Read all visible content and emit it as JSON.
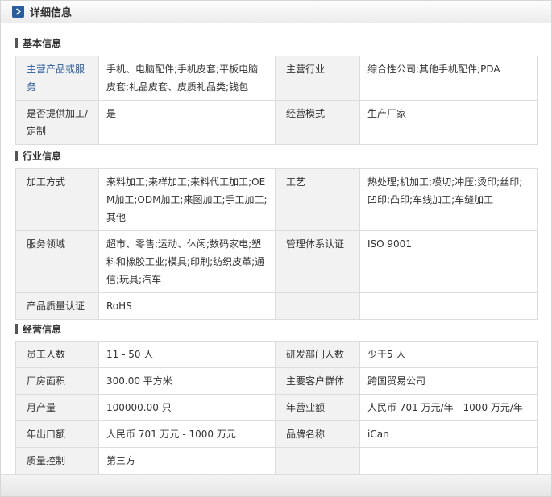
{
  "header": {
    "title": "详细信息"
  },
  "sections": [
    {
      "title": "基本信息",
      "rows": [
        [
          "主营产品或服务",
          "手机、电脑配件;手机皮套;平板电脑皮套;礼品皮套、皮质礼品类;钱包",
          "主营行业",
          "综合性公司;其他手机配件;PDA"
        ],
        [
          "是否提供加工/定制",
          "是",
          "经营模式",
          "生产厂家"
        ]
      ]
    },
    {
      "title": "行业信息",
      "rows": [
        [
          "加工方式",
          "来料加工;来样加工;来料代工加工;OEM加工;ODM加工;来图加工;手工加工;其他",
          "工艺",
          "热处理;机加工;模切;冲压;烫印;丝印;凹印;凸印;车线加工;车缝加工"
        ],
        [
          "服务领域",
          "超市、零售;运动、休闲;数码家电;塑料和橡胶工业;模具;印刷;纺织皮革;通信;玩具;汽车",
          "管理体系认证",
          "ISO 9001"
        ],
        [
          "产品质量认证",
          "RoHS",
          "",
          ""
        ]
      ]
    },
    {
      "title": "经营信息",
      "rows": [
        [
          "员工人数",
          "11 - 50 人",
          "研发部门人数",
          "少于5 人"
        ],
        [
          "厂房面积",
          "300.00 平方米",
          "主要客户群体",
          "跨国贸易公司"
        ],
        [
          "月产量",
          "100000.00 只",
          "年营业额",
          "人民币 701 万元/年 - 1000 万元/年"
        ],
        [
          "年出口额",
          "人民币 701 万元 - 1000 万元",
          "品牌名称",
          "iCan"
        ],
        [
          "质量控制",
          "第三方",
          "",
          ""
        ]
      ]
    }
  ]
}
